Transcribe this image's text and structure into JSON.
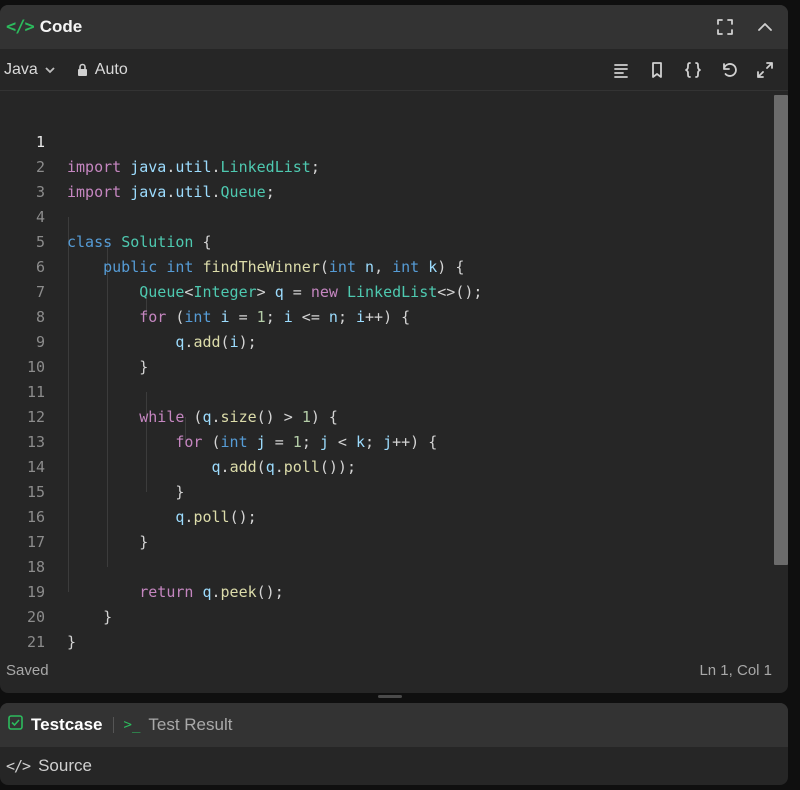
{
  "header": {
    "code_glyph": "</>",
    "title": "Code",
    "icons": [
      "fullscreen-icon",
      "chevron-up-icon"
    ]
  },
  "toolbar": {
    "language": "Java",
    "mode": "Auto",
    "icons": [
      "format-icon",
      "bookmark-icon",
      "braces-icon",
      "reset-icon",
      "expand-icon"
    ]
  },
  "editor": {
    "lines": [
      {
        "num": "1",
        "text": "import java.util.LinkedList;"
      },
      {
        "num": "2",
        "text": "import java.util.Queue;"
      },
      {
        "num": "3",
        "text": ""
      },
      {
        "num": "4",
        "text": "class Solution {"
      },
      {
        "num": "5",
        "text": "    public int findTheWinner(int n, int k) {"
      },
      {
        "num": "6",
        "text": "        Queue<Integer> q = new LinkedList<>();"
      },
      {
        "num": "7",
        "text": "        for (int i = 1; i <= n; i++) {"
      },
      {
        "num": "8",
        "text": "            q.add(i);"
      },
      {
        "num": "9",
        "text": "        }"
      },
      {
        "num": "10",
        "text": ""
      },
      {
        "num": "11",
        "text": "        while (q.size() > 1) {"
      },
      {
        "num": "12",
        "text": "            for (int j = 1; j < k; j++) {"
      },
      {
        "num": "13",
        "text": "                q.add(q.poll());"
      },
      {
        "num": "14",
        "text": "            }"
      },
      {
        "num": "15",
        "text": "            q.poll();"
      },
      {
        "num": "16",
        "text": "        }"
      },
      {
        "num": "17",
        "text": ""
      },
      {
        "num": "18",
        "text": "        return q.peek();"
      },
      {
        "num": "19",
        "text": "    }"
      },
      {
        "num": "20",
        "text": "}"
      },
      {
        "num": "21",
        "text": ""
      }
    ]
  },
  "status": {
    "saved": "Saved",
    "position": "Ln 1, Col 1"
  },
  "bottom": {
    "tab_testcase": "Testcase",
    "tab_result_glyph": ">_",
    "tab_result": "Test Result",
    "source_glyph": "</>",
    "source": "Source"
  },
  "colors": {
    "accent": "#2cbb5d",
    "keyword": "#569cd6",
    "control": "#c586c0",
    "type": "#4ec9b0",
    "function": "#dcdcaa",
    "variable": "#9cdcfe",
    "number": "#b5cea8"
  }
}
